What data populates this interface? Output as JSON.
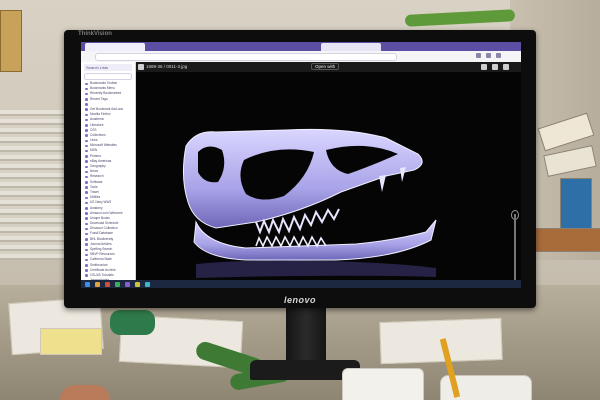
{
  "monitor": {
    "brand_top": "ThinkVision",
    "brand_bottom": "lenovo"
  },
  "browser": {
    "viewer_title": "1689-36 / 0011-3.jpg",
    "open_with_label": "Open with",
    "sidebar_header": "Search Lists"
  },
  "sidebar": {
    "items": [
      {
        "label": "Bookmarks Toolbar"
      },
      {
        "label": "Bookmarks Menu"
      },
      {
        "label": "Recently Bookmarked"
      },
      {
        "label": "Recent Tags"
      },
      {
        "label": ""
      },
      {
        "label": "Get Bookmark Add-ons"
      },
      {
        "label": "Mozilla Firefox"
      },
      {
        "label": "Academic"
      },
      {
        "label": "Literature"
      },
      {
        "label": "CSS"
      },
      {
        "label": "Collections"
      },
      {
        "label": "Links"
      },
      {
        "label": "Microsoft Websites"
      },
      {
        "label": "MSN"
      },
      {
        "label": "Printers"
      },
      {
        "label": "eBay Americas"
      },
      {
        "label": "Geography"
      },
      {
        "label": "News"
      },
      {
        "label": "Research"
      },
      {
        "label": "Software"
      },
      {
        "label": "Tools"
      },
      {
        "label": "Travel"
      },
      {
        "label": "Utilities"
      },
      {
        "label": "US Navy WW2"
      },
      {
        "label": "Anatomy"
      },
      {
        "label": "Amazon.com Welcome"
      },
      {
        "label": "Unique Books"
      },
      {
        "label": "Download Schedule"
      },
      {
        "label": "Dinosaur Collection"
      },
      {
        "label": "Fossil Database"
      },
      {
        "label": "BHL Biodiversity"
      },
      {
        "label": "Journal Articles"
      },
      {
        "label": "Spelling Search"
      },
      {
        "label": "SBVP Resources"
      },
      {
        "label": "California State"
      },
      {
        "label": "Smithsonian"
      },
      {
        "label": "Certificate Archive"
      },
      {
        "label": "CSULB Tutorials"
      },
      {
        "label": "Journal Index"
      },
      {
        "label": "Museum Catalogue"
      },
      {
        "label": "Paleography Reference"
      },
      {
        "label": "Photo Archive"
      }
    ]
  },
  "taskbar": {
    "time": "",
    "date": ""
  },
  "colors": {
    "tabbar": "#5b4ea3",
    "viewer_bg": "#050505",
    "skull": "#b8b3f0",
    "taskbar": "#1c2740"
  }
}
